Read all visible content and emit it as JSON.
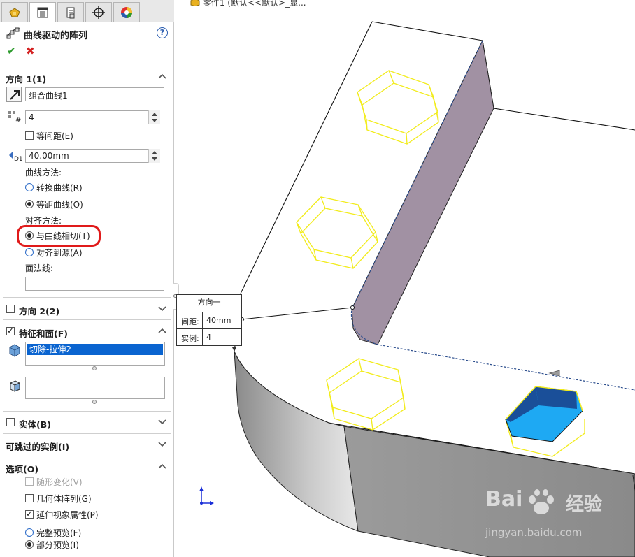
{
  "breadcrumb": "零件1 (默认<<默认>_显...",
  "property_manager": {
    "title": "曲线驱动的阵列",
    "help": "?",
    "tabs": [
      "feature-manager-icon",
      "property-manager-icon",
      "configuration-manager-icon",
      "dimxpert-icon",
      "display-manager-icon"
    ],
    "direction1": {
      "header": "方向 1(1)",
      "curve": "组合曲线1",
      "instances": "4",
      "equal_spacing": "等间距(E)",
      "spacing": "40.00mm",
      "curve_method_label": "曲线方法:",
      "curve_methods": [
        "转换曲线(R)",
        "等距曲线(O)"
      ],
      "curve_method_selected": 1,
      "align_method_label": "对齐方法:",
      "align_methods": [
        "与曲线相切(T)",
        "对齐到源(A)"
      ],
      "align_method_selected": 0,
      "face_normal_label": "面法线:",
      "face_normal": ""
    },
    "direction2": {
      "header": "方向 2(2)",
      "checked": false
    },
    "features_faces": {
      "header": "特征和面(F)",
      "checked": true,
      "features": [
        "切除-拉伸2"
      ],
      "faces": []
    },
    "bodies": {
      "header": "实体(B)",
      "checked": false
    },
    "skip_instances": {
      "header": "可跳过的实例(I)"
    },
    "options": {
      "header": "选项(O)",
      "vary_sketch": "随形变化(V)",
      "geometry_pattern": "几何体阵列(G)",
      "propagate_visual": "延伸视象属性(P)",
      "full_preview": "完整预览(F)",
      "partial_preview": "部分预览(I)",
      "preview_selected": "partial"
    }
  },
  "callout": {
    "title": "方向一",
    "spacing_label": "间距:",
    "spacing_value": "40mm",
    "instances_label": "实例:",
    "instances_value": "4"
  },
  "watermark": {
    "brand": "Bai",
    "cn": "经验",
    "url": "jingyan.baidu.com"
  },
  "colors": {
    "preview_outline": "#f2ec1c",
    "cut_face_light": "#1ea9f3",
    "cut_face_dark": "#1a4f99",
    "wall_face": "#a191a3",
    "highlight": "#e01a1a"
  }
}
